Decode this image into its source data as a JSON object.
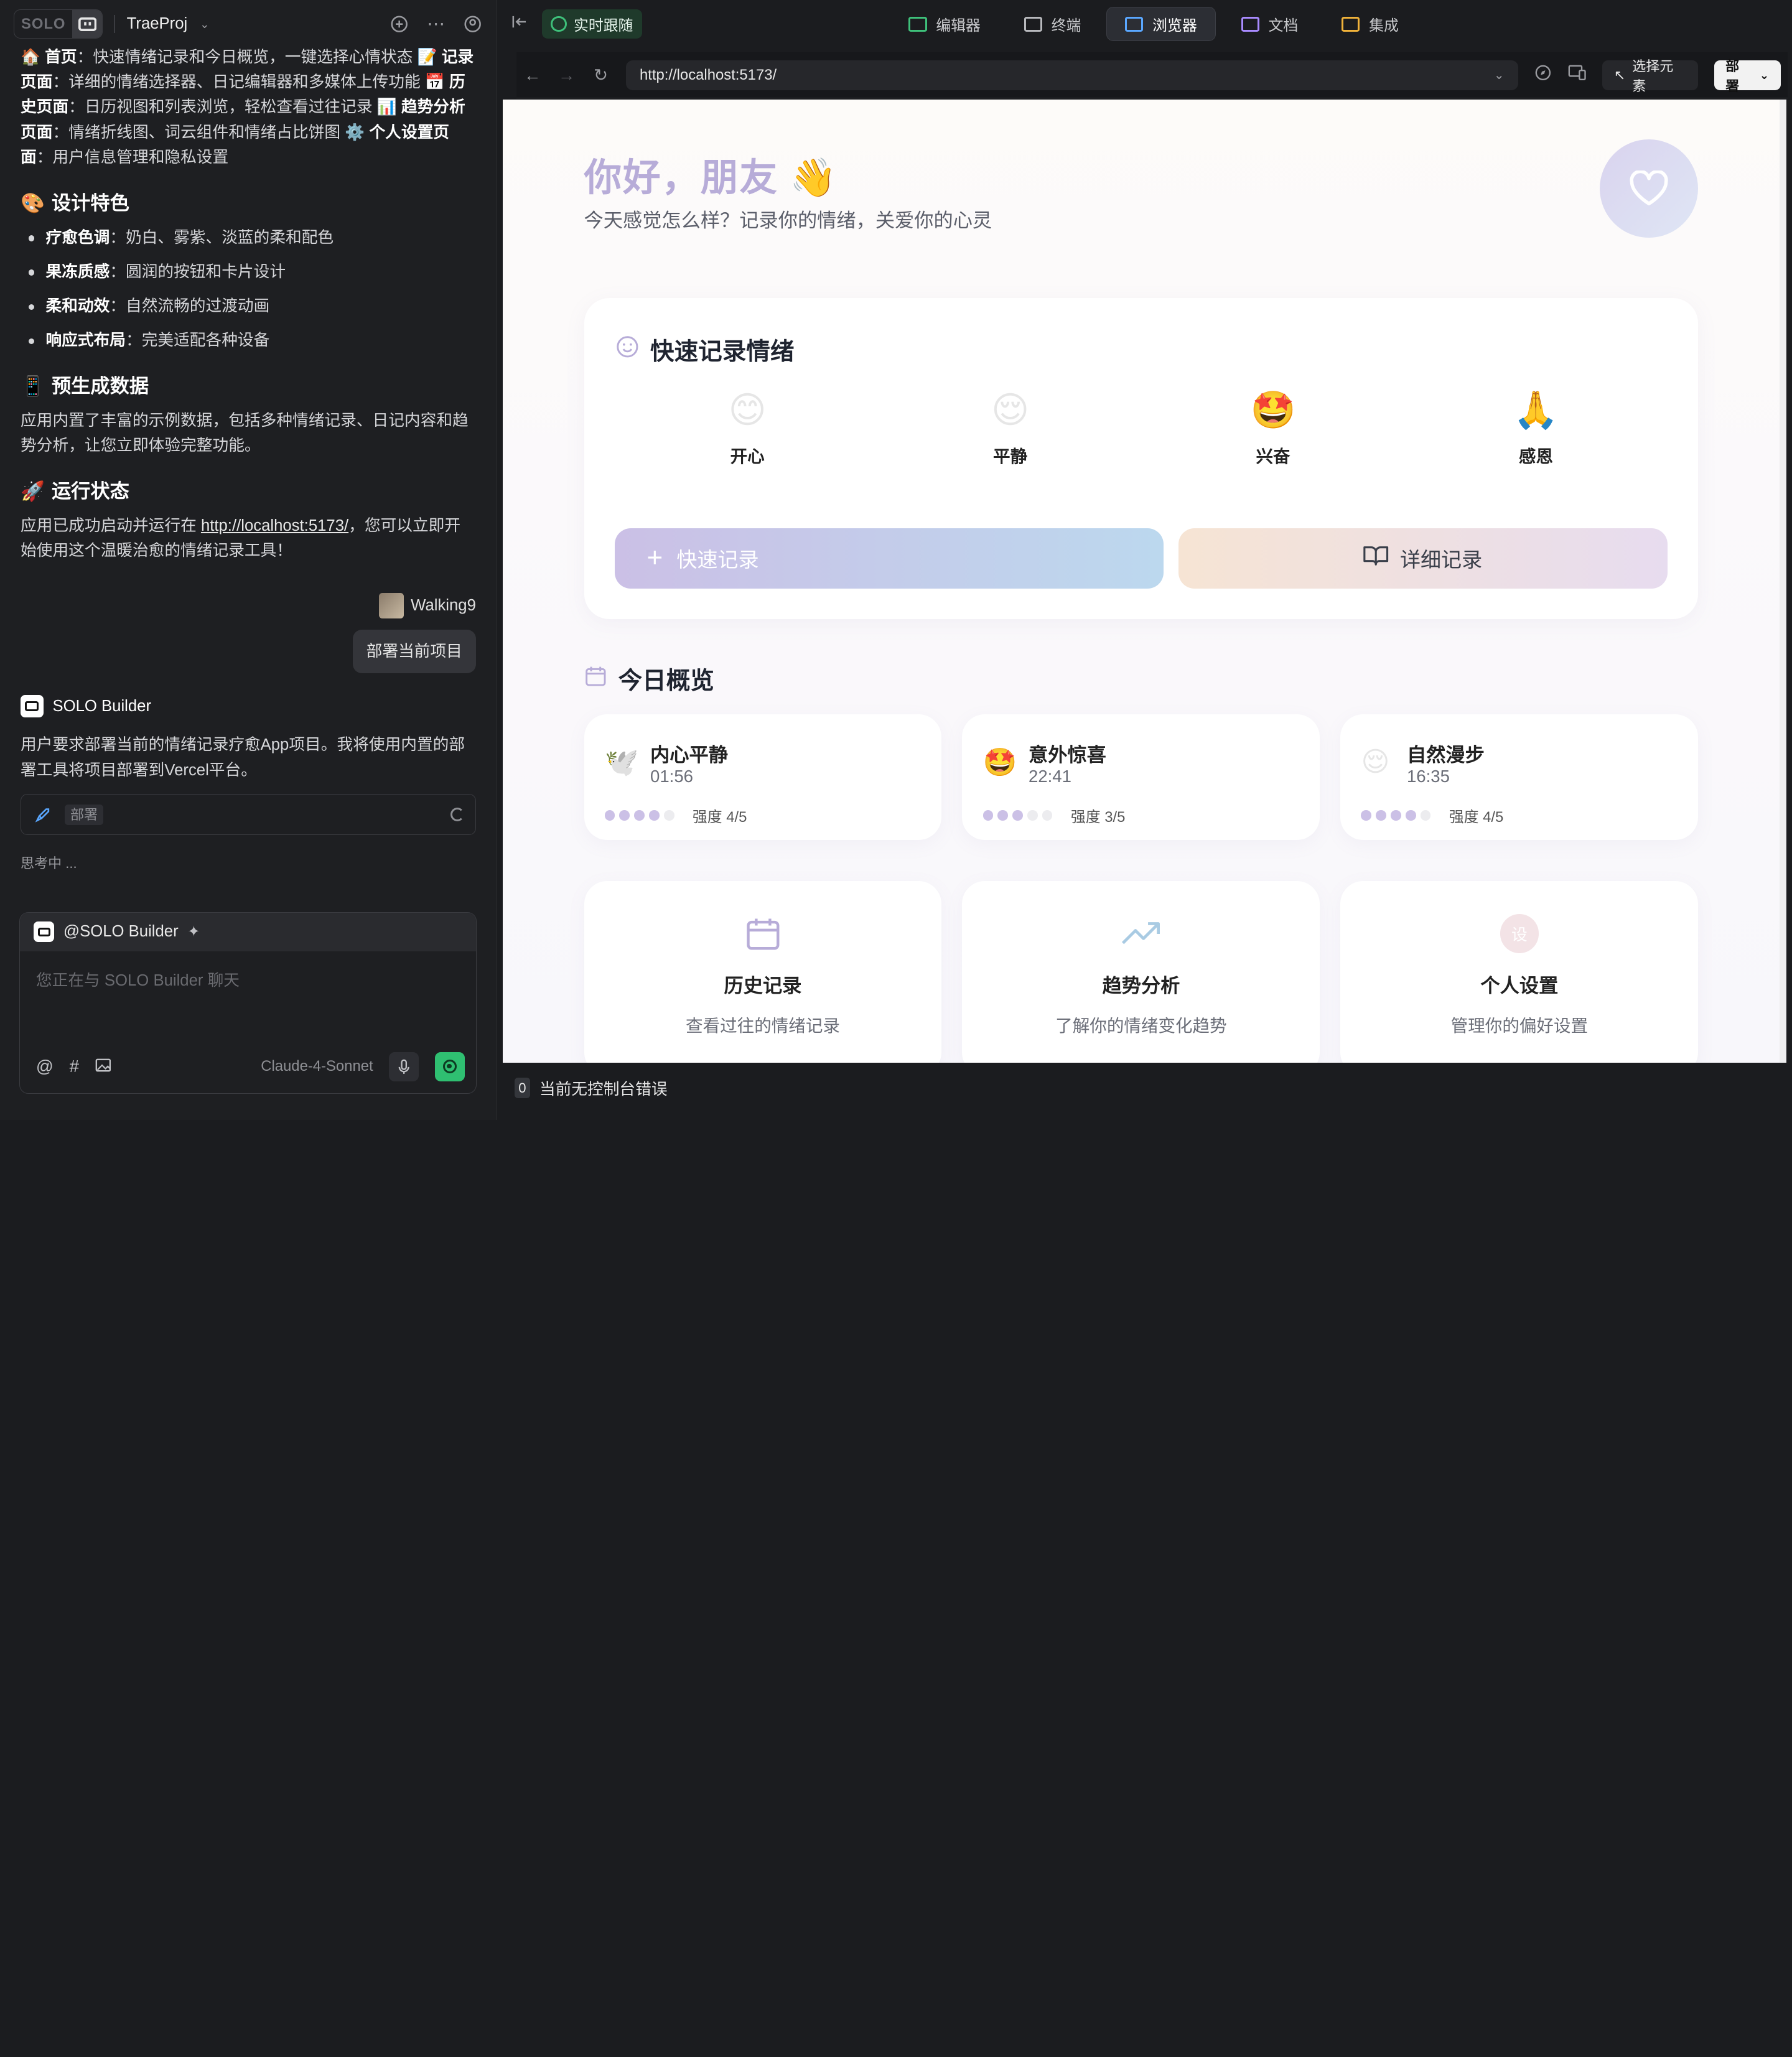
{
  "ide": {
    "logo_text": "SOLO",
    "project_name": "TraeProj"
  },
  "chat": {
    "intro_lines": [
      {
        "icon": "🏠",
        "bold": "首页",
        "text": "：快速情绪记录和今日概览，一键选择心情状态 "
      },
      {
        "icon": "📝",
        "bold": "记录页面",
        "text": "：详细的情绪选择器、日记编辑器和多媒体上传功能 "
      },
      {
        "icon": "📅",
        "bold": "历史页面",
        "text": "：日历视图和列表浏览，轻松查看过往记录 "
      },
      {
        "icon": "📊",
        "bold": "趋势分析页面",
        "text": "：情绪折线图、词云组件和情绪占比饼图 "
      },
      {
        "icon": "⚙️",
        "bold": "个人设置页面",
        "text": "：用户信息管理和隐私设置"
      }
    ],
    "design_title": "设计特色",
    "design_icon": "🎨",
    "design_items": [
      {
        "bold": "疗愈色调",
        "text": "：奶白、雾紫、淡蓝的柔和配色"
      },
      {
        "bold": "果冻质感",
        "text": "：圆润的按钮和卡片设计"
      },
      {
        "bold": "柔和动效",
        "text": "：自然流畅的过渡动画"
      },
      {
        "bold": "响应式布局",
        "text": "：完美适配各种设备"
      }
    ],
    "data_title": "预生成数据",
    "data_icon": "📱",
    "data_text": "应用内置了丰富的示例数据，包括多种情绪记录、日记内容和趋势分析，让您立即体验完整功能。",
    "status_title": "运行状态",
    "status_icon": "🚀",
    "status_prefix": "应用已成功启动并运行在 ",
    "status_link": "http://localhost:5173/",
    "status_suffix": "，您可以立即开始使用这个温暖治愈的情绪记录工具！",
    "user_name": "Walking9",
    "user_message": "部署当前项目",
    "bot_name": "SOLO Builder",
    "bot_message": "用户要求部署当前的情绪记录疗愈App项目。我将使用内置的部署工具将项目部署到Vercel平台。",
    "tool_label": "部署",
    "thinking": "思考中 ...",
    "compose_target": "@SOLO Builder",
    "compose_placeholder": "您正在与 SOLO Builder 聊天",
    "model_name": "Claude-4-Sonnet"
  },
  "toolbar": {
    "live_label": "实时跟随",
    "tabs": [
      {
        "label": "编辑器",
        "color": "#3ec07a"
      },
      {
        "label": "终端",
        "color": "#b8b9bd"
      },
      {
        "label": "浏览器",
        "color": "#5aa7ff"
      },
      {
        "label": "文档",
        "color": "#a98bff"
      },
      {
        "label": "集成",
        "color": "#f0b23a"
      }
    ],
    "url": "http://localhost:5173/",
    "select_element": "选择元素",
    "deploy": "部署"
  },
  "app": {
    "greeting": "你好，朋友 👋",
    "subtitle": "今天感觉怎么样？记录你的情绪，关爱你的心灵",
    "quick_title": "快速记录情绪",
    "emotions": [
      {
        "emoji": "😊",
        "label": "开心"
      },
      {
        "emoji": "😌",
        "label": "平静"
      },
      {
        "emoji": "🤩",
        "label": "兴奋"
      },
      {
        "emoji": "🙏",
        "label": "感恩"
      }
    ],
    "quick_button": "快速记录",
    "detail_button": "详细记录",
    "overview_title": "今日概览",
    "overview": [
      {
        "emoji": "🕊️",
        "title": "内心平静",
        "time": "01:56",
        "strength": 4,
        "strength_label": "强度 4/5"
      },
      {
        "emoji": "🤩",
        "title": "意外惊喜",
        "time": "22:41",
        "strength": 3,
        "strength_label": "强度 3/5"
      },
      {
        "emoji": "😌",
        "title": "自然漫步",
        "time": "16:35",
        "strength": 4,
        "strength_label": "强度 4/5"
      }
    ],
    "nav_cards": [
      {
        "title": "历史记录",
        "desc": "查看过往的情绪记录"
      },
      {
        "title": "趋势分析",
        "desc": "了解你的情绪变化趋势"
      },
      {
        "title": "个人设置",
        "desc": "管理你的偏好设置",
        "badge": "设"
      }
    ]
  },
  "console": {
    "count": "0",
    "text": "当前无控制台错误"
  }
}
